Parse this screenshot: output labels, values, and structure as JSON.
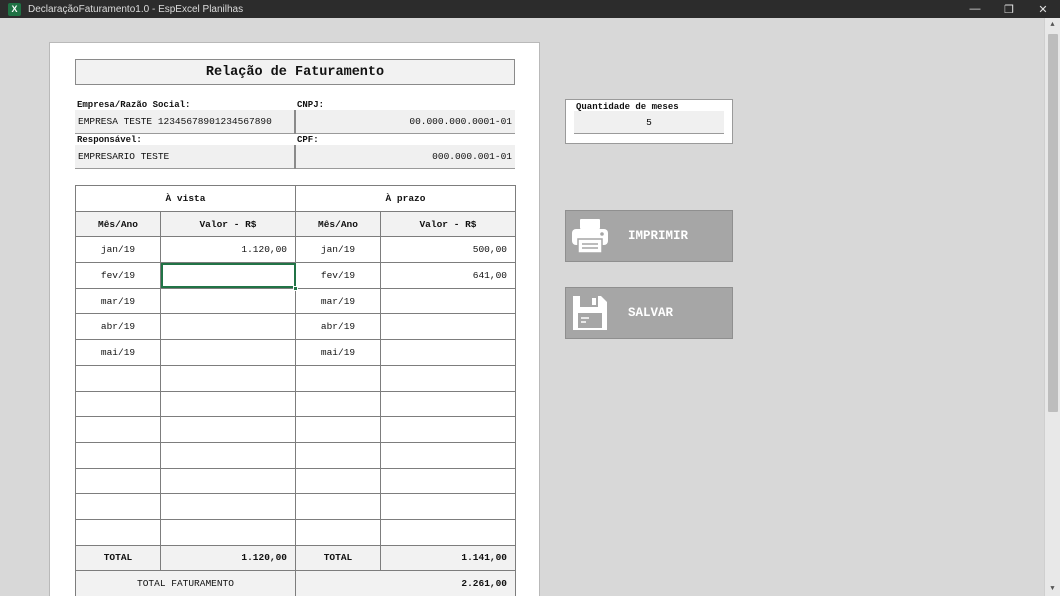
{
  "window": {
    "app_icon": "X",
    "title": "DeclaraçãoFaturamento1.0 - EspExcel Planilhas",
    "minimize": "—",
    "restore": "❐",
    "close": "✕"
  },
  "form": {
    "title": "Relação de Faturamento",
    "company_label": "Empresa/Razão Social:",
    "company_value": "EMPRESA TESTE 12345678901234567890",
    "cnpj_label": "CNPJ:",
    "cnpj_value": "00.000.000.0001-01",
    "responsible_label": "Responsável:",
    "responsible_value": "EMPRESARIO TESTE",
    "cpf_label": "CPF:",
    "cpf_value": "000.000.001-01"
  },
  "table": {
    "group_cash": "À vista",
    "group_term": "À prazo",
    "col_month": "Mês/Ano",
    "col_value": "Valor - R$",
    "rows": [
      {
        "cash_month": "jan/19",
        "cash_value": "1.120,00",
        "term_month": "jan/19",
        "term_value": "500,00"
      },
      {
        "cash_month": "fev/19",
        "cash_value": "",
        "term_month": "fev/19",
        "term_value": "641,00"
      },
      {
        "cash_month": "mar/19",
        "cash_value": "",
        "term_month": "mar/19",
        "term_value": ""
      },
      {
        "cash_month": "abr/19",
        "cash_value": "",
        "term_month": "abr/19",
        "term_value": ""
      },
      {
        "cash_month": "mai/19",
        "cash_value": "",
        "term_month": "mai/19",
        "term_value": ""
      },
      {
        "cash_month": "",
        "cash_value": "",
        "term_month": "",
        "term_value": ""
      },
      {
        "cash_month": "",
        "cash_value": "",
        "term_month": "",
        "term_value": ""
      },
      {
        "cash_month": "",
        "cash_value": "",
        "term_month": "",
        "term_value": ""
      },
      {
        "cash_month": "",
        "cash_value": "",
        "term_month": "",
        "term_value": ""
      },
      {
        "cash_month": "",
        "cash_value": "",
        "term_month": "",
        "term_value": ""
      },
      {
        "cash_month": "",
        "cash_value": "",
        "term_month": "",
        "term_value": ""
      },
      {
        "cash_month": "",
        "cash_value": "",
        "term_month": "",
        "term_value": ""
      }
    ],
    "total_label": "TOTAL",
    "total_cash": "1.120,00",
    "total_term": "1.141,00",
    "grand_total_label": "TOTAL FATURAMENTO",
    "grand_total_value": "2.261,00"
  },
  "panel": {
    "months_label": "Quantidade de meses",
    "months_value": "5",
    "print_label": "IMPRIMIR",
    "print_icon": "printer-icon",
    "save_label": "SALVAR",
    "save_icon": "floppy-disk-icon"
  },
  "colors": {
    "selection": "#217346",
    "button_bg": "#a6a6a6"
  }
}
